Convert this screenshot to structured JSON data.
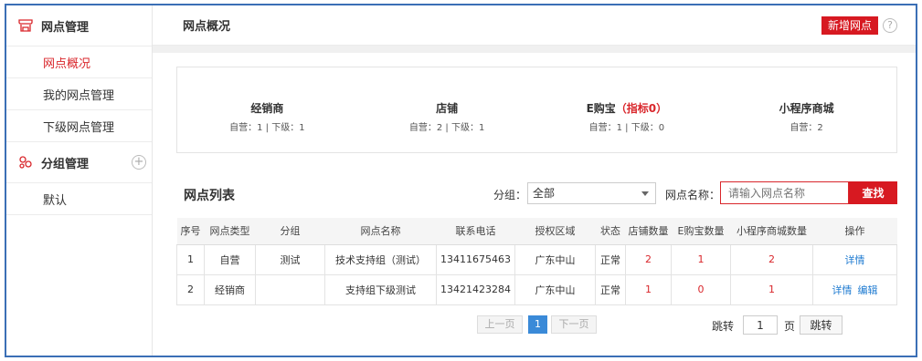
{
  "sidebar": {
    "group1": {
      "label": "网点管理",
      "icon": "store-icon"
    },
    "items": [
      {
        "label": "网点概况",
        "active": true
      },
      {
        "label": "我的网点管理",
        "active": false
      },
      {
        "label": "下级网点管理",
        "active": false
      }
    ],
    "group2": {
      "label": "分组管理",
      "icon": "group-icon",
      "add": "+"
    },
    "group2_items": [
      {
        "label": "默认"
      }
    ]
  },
  "header": {
    "title": "网点概况",
    "add_button": "新增网点",
    "help": "?"
  },
  "stats": [
    {
      "name": "经销商",
      "highlight": "",
      "sub": "自营：1 | 下级：1"
    },
    {
      "name": "店铺",
      "highlight": "",
      "sub": "自营：2 | 下级：1"
    },
    {
      "name": "E购宝",
      "highlight": "（指标0）",
      "sub": "自营：1 | 下级：0"
    },
    {
      "name": "小程序商城",
      "highlight": "",
      "sub": "自营：2"
    }
  ],
  "list": {
    "title": "网点列表",
    "group_label": "分组：",
    "group_value": "全部",
    "name_label": "网点名称：",
    "name_placeholder": "请输入网点名称",
    "search_button": "查找"
  },
  "table": {
    "headers": [
      "序号",
      "网点类型",
      "分组",
      "网点名称",
      "联系电话",
      "授权区域",
      "状态",
      "店铺数量",
      "E购宝数量",
      "小程序商城数量",
      "操作"
    ],
    "rows": [
      {
        "no": "1",
        "type": "自营",
        "group": "测试",
        "name": "技术支持组（测试）",
        "phone": "13411675463",
        "region": "广东中山",
        "status": "正常",
        "shops": "2",
        "egb": "1",
        "mini": "2",
        "actions": [
          "详情"
        ]
      },
      {
        "no": "2",
        "type": "经销商",
        "group": "",
        "name": "支持组下级测试",
        "phone": "13421423284",
        "region": "广东中山",
        "status": "正常",
        "shops": "1",
        "egb": "0",
        "mini": "1",
        "actions": [
          "详情",
          "编辑"
        ]
      }
    ]
  },
  "pagination": {
    "prev": "上一页",
    "current": "1",
    "next": "下一页",
    "jump_label": "跳转",
    "jump_value": "1",
    "page_label": "页",
    "jump_button": "跳转"
  },
  "colors": {
    "accent": "#d71921",
    "link": "#1f7bd1",
    "frame": "#3b6fb6",
    "pager_active": "#3a8ad8"
  }
}
